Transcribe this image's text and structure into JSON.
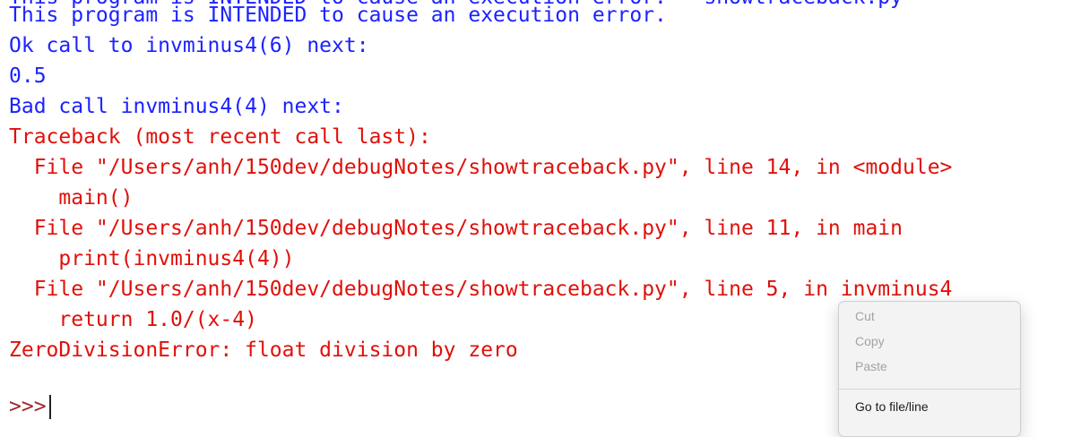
{
  "console": {
    "partial_top_line": "This program is INTENDED to cause an execution error. — showtraceback.py",
    "lines": [
      {
        "text": "This program is INTENDED to cause an execution error.",
        "kind": "out"
      },
      {
        "text": "Ok call to invminus4(6) next:",
        "kind": "out"
      },
      {
        "text": "0.5",
        "kind": "out"
      },
      {
        "text": "Bad call invminus4(4) next:",
        "kind": "out"
      },
      {
        "text": "Traceback (most recent call last):",
        "kind": "err"
      },
      {
        "text": "  File \"/Users/anh/150dev/debugNotes/showtraceback.py\", line 14, in <module>",
        "kind": "err"
      },
      {
        "text": "    main()",
        "kind": "err"
      },
      {
        "text": "  File \"/Users/anh/150dev/debugNotes/showtraceback.py\", line 11, in main",
        "kind": "err"
      },
      {
        "text": "    print(invminus4(4))",
        "kind": "err"
      },
      {
        "text": "  File \"/Users/anh/150dev/debugNotes/showtraceback.py\", line 5, in invminus4",
        "kind": "err"
      },
      {
        "text": "    return 1.0/(x-4)",
        "kind": "err"
      },
      {
        "text": "ZeroDivisionError: float division by zero",
        "kind": "err"
      }
    ],
    "prompt": ">>>"
  },
  "context_menu": {
    "items": [
      {
        "label": "Cut",
        "enabled": false
      },
      {
        "label": "Copy",
        "enabled": false
      },
      {
        "label": "Paste",
        "enabled": false
      },
      {
        "label": "Go to file/line",
        "enabled": true
      }
    ]
  },
  "colors": {
    "output_text": "#1c22ff",
    "error_text": "#e0100a",
    "prompt_text": "#a2262a"
  }
}
